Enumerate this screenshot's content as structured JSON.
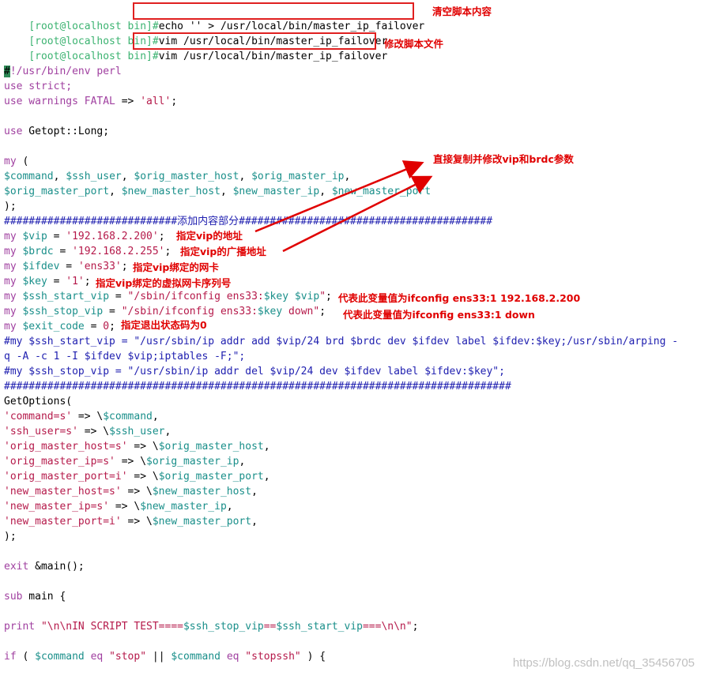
{
  "colors": {
    "prompt": "#3cb371",
    "keyword": "#a040a0",
    "variable": "#1a8f8a",
    "string": "#b5194a",
    "comment": "#2020b0",
    "text": "#000000",
    "annotation": "#e00000",
    "cursor": "#2e8b57"
  },
  "prompt": "[root@localhost bin]#",
  "commands": [
    {
      "text": "echo '' > /usr/local/bin/master_ip_failover",
      "note": "清空脚本内容"
    },
    {
      "text": "vim /usr/local/bin/master_ip_failover",
      "note": ""
    },
    {
      "text": "vim /usr/local/bin/master_ip_failover",
      "note": "修改脚本文件"
    }
  ],
  "code_lines": [
    [
      [
        "#",
        "cursor"
      ],
      [
        "!/usr/bin/env perl",
        "keyword"
      ]
    ],
    [
      [
        "use strict;",
        "keyword"
      ]
    ],
    [
      [
        "use warnings ",
        "keyword"
      ],
      [
        "FATAL",
        "keyword"
      ],
      [
        " => ",
        "text"
      ],
      [
        "'all'",
        "string"
      ],
      [
        ";",
        "text"
      ]
    ],
    [],
    [
      [
        "use",
        "keyword"
      ],
      [
        " Getopt::Long;",
        "text"
      ]
    ],
    [],
    [
      [
        "my",
        "keyword"
      ],
      [
        " (",
        "text"
      ]
    ],
    [
      [
        "$command",
        "variable"
      ],
      [
        ", ",
        "text"
      ],
      [
        "$ssh_user",
        "variable"
      ],
      [
        ", ",
        "text"
      ],
      [
        "$orig_master_host",
        "variable"
      ],
      [
        ", ",
        "text"
      ],
      [
        "$orig_master_ip",
        "variable"
      ],
      [
        ",",
        "text"
      ]
    ],
    [
      [
        "$orig_master_port",
        "variable"
      ],
      [
        ", ",
        "text"
      ],
      [
        "$new_master_host",
        "variable"
      ],
      [
        ", ",
        "text"
      ],
      [
        "$new_master_ip",
        "variable"
      ],
      [
        ", ",
        "text"
      ],
      [
        "$new_master_port",
        "variable"
      ]
    ],
    [
      [
        ");",
        "text"
      ]
    ],
    [
      [
        "############################添加内容部分#########################################",
        "comment"
      ]
    ],
    [
      [
        "my",
        "keyword"
      ],
      [
        " ",
        "text"
      ],
      [
        "$vip",
        "variable"
      ],
      [
        " = ",
        "text"
      ],
      [
        "'192.168.2.200'",
        "string"
      ],
      [
        ";",
        "text"
      ]
    ],
    [
      [
        "my",
        "keyword"
      ],
      [
        " ",
        "text"
      ],
      [
        "$brdc",
        "variable"
      ],
      [
        " = ",
        "text"
      ],
      [
        "'192.168.2.255'",
        "string"
      ],
      [
        ";",
        "text"
      ]
    ],
    [
      [
        "my",
        "keyword"
      ],
      [
        " ",
        "text"
      ],
      [
        "$ifdev",
        "variable"
      ],
      [
        " = ",
        "text"
      ],
      [
        "'ens33'",
        "string"
      ],
      [
        ";",
        "text"
      ]
    ],
    [
      [
        "my",
        "keyword"
      ],
      [
        " ",
        "text"
      ],
      [
        "$key",
        "variable"
      ],
      [
        " = ",
        "text"
      ],
      [
        "'1'",
        "string"
      ],
      [
        ";",
        "text"
      ]
    ],
    [
      [
        "my",
        "keyword"
      ],
      [
        " ",
        "text"
      ],
      [
        "$ssh_start_vip",
        "variable"
      ],
      [
        " = ",
        "text"
      ],
      [
        "\"/sbin/ifconfig ens33:",
        "string"
      ],
      [
        "$key",
        "variable"
      ],
      [
        " ",
        "string"
      ],
      [
        "$vip",
        "variable"
      ],
      [
        "\"",
        "string"
      ],
      [
        ";",
        "text"
      ]
    ],
    [
      [
        "my",
        "keyword"
      ],
      [
        " ",
        "text"
      ],
      [
        "$ssh_stop_vip",
        "variable"
      ],
      [
        " = ",
        "text"
      ],
      [
        "\"/sbin/ifconfig ens33:",
        "string"
      ],
      [
        "$key",
        "variable"
      ],
      [
        " down\"",
        "string"
      ],
      [
        ";",
        "text"
      ]
    ],
    [
      [
        "my",
        "keyword"
      ],
      [
        " ",
        "text"
      ],
      [
        "$exit_code",
        "variable"
      ],
      [
        " = ",
        "text"
      ],
      [
        "0",
        "string"
      ],
      [
        ";",
        "text"
      ]
    ],
    [
      [
        "#my $ssh_start_vip = \"/usr/sbin/ip addr add $vip/24 brd $brdc dev $ifdev label $ifdev:$key;/usr/sbin/arping -",
        "comment"
      ]
    ],
    [
      [
        "q -A -c 1 -I $ifdev $vip;iptables -F;\";",
        "comment"
      ]
    ],
    [
      [
        "#my $ssh_stop_vip = \"/usr/sbin/ip addr del $vip/24 dev $ifdev label $ifdev:$key\";",
        "comment"
      ]
    ],
    [
      [
        "##################################################################################",
        "comment"
      ]
    ],
    [
      [
        "GetOptions(",
        "text"
      ]
    ],
    [
      [
        "'command=s'",
        "string"
      ],
      [
        " => \\",
        "text"
      ],
      [
        "$command",
        "variable"
      ],
      [
        ",",
        "text"
      ]
    ],
    [
      [
        "'ssh_user=s'",
        "string"
      ],
      [
        " => \\",
        "text"
      ],
      [
        "$ssh_user",
        "variable"
      ],
      [
        ",",
        "text"
      ]
    ],
    [
      [
        "'orig_master_host=s'",
        "string"
      ],
      [
        " => \\",
        "text"
      ],
      [
        "$orig_master_host",
        "variable"
      ],
      [
        ",",
        "text"
      ]
    ],
    [
      [
        "'orig_master_ip=s'",
        "string"
      ],
      [
        " => \\",
        "text"
      ],
      [
        "$orig_master_ip",
        "variable"
      ],
      [
        ",",
        "text"
      ]
    ],
    [
      [
        "'orig_master_port=i'",
        "string"
      ],
      [
        " => \\",
        "text"
      ],
      [
        "$orig_master_port",
        "variable"
      ],
      [
        ",",
        "text"
      ]
    ],
    [
      [
        "'new_master_host=s'",
        "string"
      ],
      [
        " => \\",
        "text"
      ],
      [
        "$new_master_host",
        "variable"
      ],
      [
        ",",
        "text"
      ]
    ],
    [
      [
        "'new_master_ip=s'",
        "string"
      ],
      [
        " => \\",
        "text"
      ],
      [
        "$new_master_ip",
        "variable"
      ],
      [
        ",",
        "text"
      ]
    ],
    [
      [
        "'new_master_port=i'",
        "string"
      ],
      [
        " => \\",
        "text"
      ],
      [
        "$new_master_port",
        "variable"
      ],
      [
        ",",
        "text"
      ]
    ],
    [
      [
        ");",
        "text"
      ]
    ],
    [],
    [
      [
        "exit",
        "keyword"
      ],
      [
        " &main();",
        "text"
      ]
    ],
    [],
    [
      [
        "sub",
        "keyword"
      ],
      [
        " main {",
        "text"
      ]
    ],
    [],
    [
      [
        "print",
        "keyword"
      ],
      [
        " ",
        "text"
      ],
      [
        "\"\\n\\nIN SCRIPT TEST====",
        "string"
      ],
      [
        "$ssh_stop_vip",
        "variable"
      ],
      [
        "==",
        "string"
      ],
      [
        "$ssh_start_vip",
        "variable"
      ],
      [
        "===\\n\\n\"",
        "string"
      ],
      [
        ";",
        "text"
      ]
    ],
    [],
    [
      [
        "if",
        "keyword"
      ],
      [
        " ( ",
        "text"
      ],
      [
        "$command",
        "variable"
      ],
      [
        " ",
        "text"
      ],
      [
        "eq",
        "keyword"
      ],
      [
        " ",
        "text"
      ],
      [
        "\"stop\"",
        "string"
      ],
      [
        " || ",
        "text"
      ],
      [
        "$command",
        "variable"
      ],
      [
        " ",
        "text"
      ],
      [
        "eq",
        "keyword"
      ],
      [
        " ",
        "text"
      ],
      [
        "\"stopssh\"",
        "string"
      ],
      [
        " ) {",
        "text"
      ]
    ]
  ],
  "annotations": {
    "copy_note": "直接复制并修改vip和brdc参数",
    "vip": "指定vip的地址",
    "brdc": "指定vip的广播地址",
    "ifdev": "指定vip绑定的网卡",
    "key": "指定vip绑定的虚拟网卡序列号",
    "start_vip": "代表此变量值为ifconfig ens33:1 192.168.2.200",
    "stop_vip": "代表此变量值为ifconfig ens33:1 down",
    "exit_code": "指定退出状态码为0"
  },
  "watermark": "https://blog.csdn.net/qq_35456705"
}
